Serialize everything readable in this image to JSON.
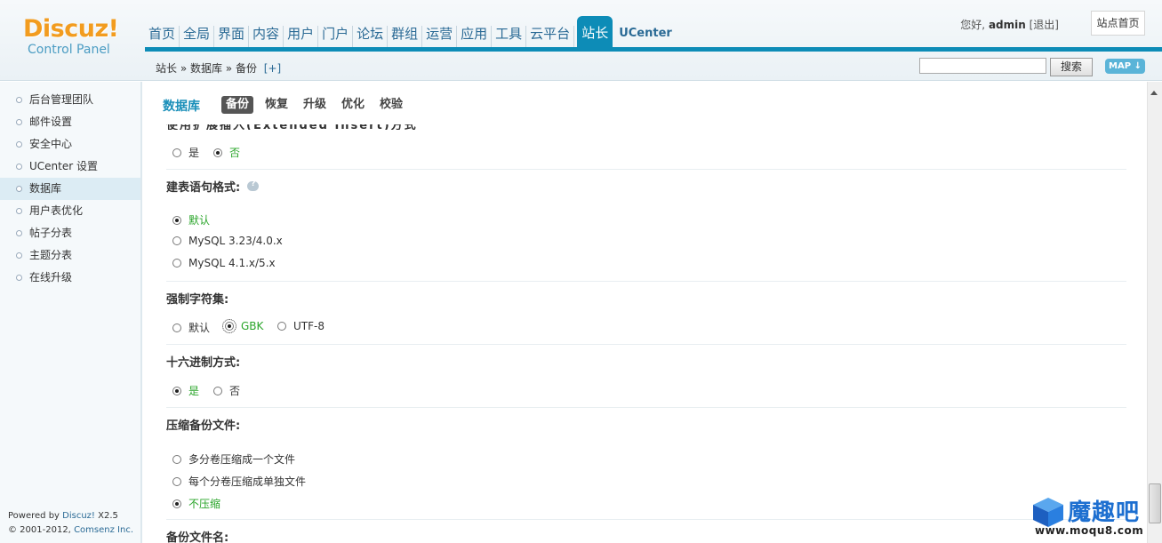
{
  "header": {
    "logo_brand": "Discuz!",
    "logo_sub": "Control Panel",
    "nav": [
      "首页",
      "全局",
      "界面",
      "内容",
      "用户",
      "门户",
      "论坛",
      "群组",
      "运营",
      "应用",
      "工具",
      "云平台",
      "站长",
      "UCenter"
    ],
    "nav_active_index": 12,
    "greeting": "您好,",
    "username": "admin",
    "logout": "[退出]",
    "site_home": "站点首页",
    "breadcrumb": "站长 » 数据库 » 备份",
    "breadcrumb_add": "[+]",
    "search_button": "搜索",
    "map_button": "MAP",
    "accent_color": "#0d8cb7"
  },
  "sidebar": {
    "items": [
      "后台管理团队",
      "邮件设置",
      "安全中心",
      "UCenter 设置",
      "数据库",
      "用户表优化",
      "帖子分表",
      "主题分表",
      "在线升级"
    ],
    "active_index": 4,
    "powered_prefix": "Powered by",
    "powered_brand": "Discuz!",
    "powered_version": "X2.5",
    "copyright_prefix": "© 2001-2012,",
    "copyright_company": "Comsenz Inc."
  },
  "main": {
    "title": "数据库",
    "tabs": [
      "备份",
      "恢复",
      "升级",
      "优化",
      "校验"
    ],
    "tab_active_index": 0,
    "partial_label": "使用扩展插入(Extended Insert)方式",
    "ext_insert": {
      "options": [
        "是",
        "否"
      ],
      "selected": "否"
    },
    "sql_format": {
      "label": "建表语句格式:",
      "options": [
        "默认",
        "MySQL 3.23/4.0.x",
        "MySQL 4.1.x/5.x"
      ],
      "selected": "默认"
    },
    "charset": {
      "label": "强制字符集:",
      "options": [
        "默认",
        "GBK",
        "UTF-8"
      ],
      "selected": "GBK"
    },
    "hex": {
      "label": "十六进制方式:",
      "options": [
        "是",
        "否"
      ],
      "selected": "是"
    },
    "compress": {
      "label": "压缩备份文件:",
      "options": [
        "多分卷压缩成一个文件",
        "每个分卷压缩成单独文件",
        "不压缩"
      ],
      "selected": "不压缩"
    },
    "filename_label": "备份文件名:"
  },
  "watermark": {
    "text": "魔趣吧",
    "url": "www.moqu8.com"
  }
}
